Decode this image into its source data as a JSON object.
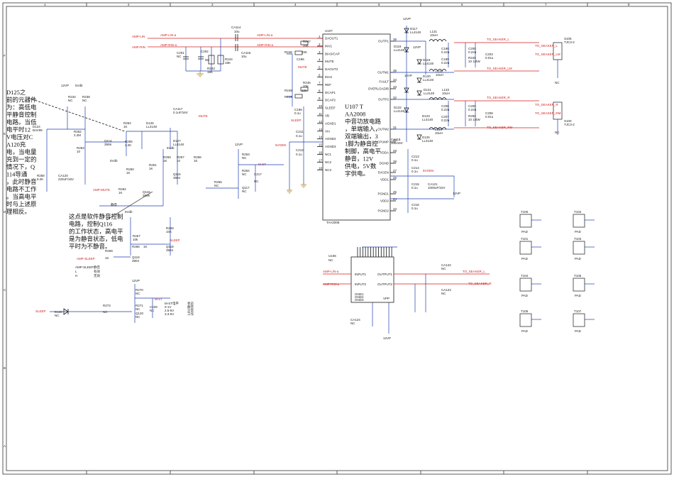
{
  "ic_main": {
    "ref": "U107",
    "part": "TAA2008",
    "left_pins": [
      "DAOUT1",
      "INV1",
      "BIAS/CAP",
      "MUTE",
      "DAOUT2",
      "INV2",
      "REF",
      "DCAP1",
      "DCAP2",
      "SLEEP",
      "VB",
      "AGND1",
      "VIA",
      "AGND2",
      "AGND3",
      "NC1",
      "NC2",
      "NC3"
    ],
    "right_pins": [
      "OUTP1",
      "OUTM1",
      "FAULT",
      "OVERLOAD/B",
      "OUTP2",
      "OUTM2",
      "CPUMP",
      "VDDA",
      "DGND",
      "5VGEN",
      "VDD1",
      "PGND1",
      "VDD2",
      "PGND2"
    ],
    "left_nums": [
      "1",
      "2",
      "3",
      "4",
      "5",
      "6",
      "7",
      "8",
      "9",
      "10",
      "11",
      "12",
      "13",
      "14",
      "15",
      "16",
      "17",
      "18"
    ],
    "right_nums": [
      "36",
      "35",
      "34",
      "33",
      "32",
      "31",
      "30",
      "29",
      "28",
      "27",
      "26",
      "25",
      "24",
      "23"
    ]
  },
  "ic_alt": {
    "ref": "U106",
    "nc": "NC",
    "pins_left": [
      "INPUT1",
      "INPUT2",
      "GND1",
      "GND2",
      "GND3"
    ],
    "pins_right": [
      "OUTPUT1",
      "OUTPUT2",
      "VPP"
    ]
  },
  "nets": {
    "amp_lin": "AMP-LIN",
    "amp_rin": "AMP-RIN",
    "amp_lin_a": "AMP-L/N-a",
    "amp_rin_a": "AMP-RIN-a",
    "mute": "MUTE",
    "sleep": "SLEEP",
    "svgen": "5VGEN",
    "mst": "M-ST",
    "amp_mute": "AMP-MUTE",
    "amp_sleep": "AMP-SLEEP",
    "to_speaker_l": "TO_SEAKER_L",
    "to_speaker_lm": "TO_SEAKER_LM",
    "to_speaker_r": "TO_SEAKER_R",
    "to_speaker_rm": "TO_SEAKER_RM",
    "v12": "12VP",
    "v5": "5Vdb"
  },
  "connectors": [
    {
      "ref": "S105",
      "type": "TJC3-2"
    },
    {
      "ref": "S100",
      "type": "TJC3-2"
    }
  ],
  "pads": [
    {
      "ref": "T100",
      "label": "PAD"
    },
    {
      "ref": "T102",
      "label": "PAD"
    },
    {
      "ref": "T101",
      "label": "PAD"
    },
    {
      "ref": "T103",
      "label": "PAD"
    },
    {
      "ref": "T104",
      "label": "PAD"
    },
    {
      "ref": "T105",
      "label": "PAD"
    },
    {
      "ref": "T106",
      "label": "PAD"
    },
    {
      "ref": "T107",
      "label": "PAD"
    }
  ],
  "parts": {
    "ca114": "CA114",
    "ca114_v": "10u",
    "ca115": "CA115",
    "ca115_v": "10u",
    "c201": "C201",
    "c202": "C202",
    "r243": "R243",
    "r243_v": "18K",
    "r244": "R244",
    "r244_v": "18K",
    "r246": "R246",
    "r246_v": "20K",
    "r247": "R247",
    "r247_v": "20K",
    "r248": "R248",
    "r248_v": "22K",
    "r249": "R249",
    "r249_v": "22K",
    "d117": "D117",
    "d117_v": "LL4148",
    "d118": "D118",
    "d118_v": "LL4148",
    "d119": "D119",
    "d119_v": "LL4148",
    "d120": "D120",
    "d120_v": "LL4148",
    "d121": "D121",
    "d121_v": "LL4148",
    "d122": "D122",
    "d122_v": "LL4148",
    "d123": "D123",
    "d123_v": "LL4148",
    "d125": "D125",
    "d125_v": "LL4148",
    "l131": "L131",
    "l131_v": "10uH",
    "l132": "L132",
    "l132_v": "10uH",
    "l133": "L133",
    "l133_v": "10uH",
    "l134": "L134",
    "l134_v": "10uH",
    "c198": "C198",
    "c198_v": "0.22u",
    "c199": "C199",
    "c199_v": "0.22u",
    "c200": "C200",
    "c200_v": "0.22u",
    "c203": "C203",
    "c203_v": "0.01u",
    "c206": "C206",
    "c206_v": "0.22u",
    "c207": "C207",
    "c207_v": "0.22u",
    "c208": "C208",
    "c208_v": "0.01u",
    "r245": "R245",
    "r245_v": "10 1/4W",
    "r250": "R250",
    "r250_v": "10 1/4W",
    "c196": "C196",
    "c196_v": "0.1u",
    "c211": "C211",
    "c212": "C212",
    "c213": "C213",
    "c214": "C214",
    "c215": "C215",
    "c216": "C216",
    "cap_v": "0.1u",
    "ca118": "CA118",
    "ca118_v": "10u/16V",
    "ca121": "CA121",
    "ca121_v": "1000uF/16V",
    "d124": "D124",
    "d124_v": "BAV99",
    "r232": "R232",
    "r232_v": "NC",
    "r238": "R238",
    "r238_v": "NC",
    "r252": "R252",
    "r252_v": "2.2M",
    "r253": "R253",
    "r253_v": "10",
    "r254": "R254",
    "r254_v": "1K",
    "r255": "R255",
    "r255_v": "2.2K",
    "r258": "R258",
    "r258_v": "8.2K",
    "ca120": "CA120",
    "ca120_v": "220uF/16V",
    "q114": "Q114",
    "q114_v": "3906",
    "ca117": "CA117",
    "ca117_v": "0.1uF/16V",
    "d127": "D127",
    "d127_v": "LL4148",
    "d126": "D126",
    "d126_v": "LL4148",
    "r260": "R260",
    "r260_v": "1K",
    "r261": "R261",
    "r261_v": "1K",
    "r262": "R262",
    "r262_v": "1K",
    "r259": "R259",
    "r259_v": "1K",
    "r257": "R257",
    "r257_v": "10",
    "r256": "R256",
    "r256_v": "1K",
    "q115": "Q115",
    "q115_v": "3904",
    "q116": "Q116",
    "q116_v": "3906",
    "r263": "R263",
    "r263_v": "NC",
    "r264": "R264",
    "r264_v": "NC",
    "r265": "R265",
    "r265_v": "NC",
    "q117": "Q117",
    "q117_v": "NC",
    "c217": "C217",
    "c217_v": "NC",
    "r267": "R267",
    "r267_v": "10k",
    "r268": "R268",
    "r268_v": "10K",
    "r269": "R269",
    "r269_v": "1K",
    "r266": "R266",
    "r266_v": "1K",
    "q118": "Q118",
    "q118_v": "3904",
    "q119": "Q119",
    "q119_v": "3904",
    "r270": "R270",
    "r270_v": "NC",
    "r273": "R273",
    "r273_v": "NC",
    "r271": "R271",
    "r271_v": "NC",
    "q120": "Q120",
    "q120_v": "NC",
    "c229": "C229",
    "c229_v": "NC",
    "d128": "D128",
    "d128_v": "NC",
    "ca122": "CA122",
    "ca122_v": "NC",
    "ca123": "CA123",
    "ca123_v": "NC",
    "ca124": "CA124",
    "ca124_v": "NC",
    "nc": "NC"
  },
  "notes": {
    "d125_note": "D125之前的元器件为：高低电平静音控制电路。当低电平时12V电压对CA120充电，当电量充到一定的情况下，Q114导通，此时静音电路不工作。当高电平时与上述原理相反。",
    "u107_note": "U107 TAA2008中音功放电路，单端输入，双端输出，31脚为静音控制脚，高电平静音，12V供电，5V数字供电。",
    "sleep_note": "这点是软件静音控制电路，控制Q116的工作状态，高电平是为静音状态，低电平时为不静音。",
    "mute_tag": "静音",
    "table_a": [
      "AMP-SLEEP",
      "L",
      "H"
    ],
    "table_b": [
      "静音",
      "有效",
      "无效"
    ],
    "table_c": [
      "M-ST电平",
      "0-1V",
      "2.5-5V",
      "3.3-5V"
    ],
    "table_d": [
      "状态",
      "静音",
      "正常",
      "工作"
    ]
  },
  "frame": {
    "cols": [
      "1",
      "2",
      "3",
      "4",
      "5",
      "6",
      "7",
      "8"
    ],
    "rows": [
      "A",
      "B",
      "C",
      "D",
      "E",
      "F"
    ]
  }
}
